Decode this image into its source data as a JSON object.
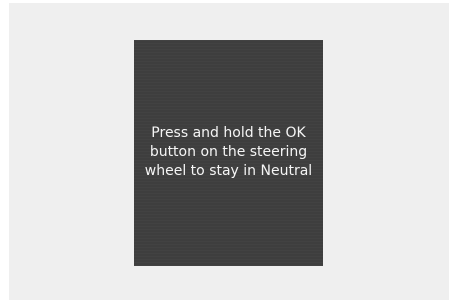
{
  "display": {
    "message_lines": [
      "Press and hold the OK",
      "button on the steering",
      "wheel to stay in Neutral"
    ]
  },
  "colors": {
    "page_background": "#efefef",
    "panel_background": "#3f3f3f",
    "text": "#f5f5f5"
  }
}
